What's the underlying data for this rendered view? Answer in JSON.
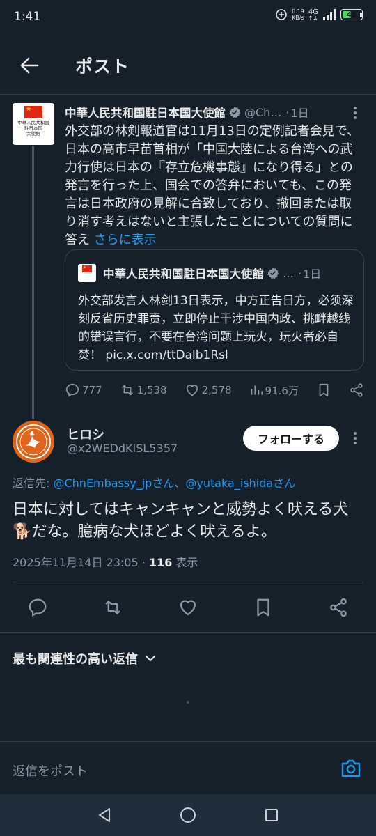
{
  "status_bar": {
    "time": "1:41",
    "speed_value": "0.19",
    "speed_unit": "KB/s",
    "network": "4G",
    "battery": "45",
    "battery_level": 0.45
  },
  "header": {
    "title": "ポスト",
    "back_icon": "arrow-left-icon"
  },
  "original_post": {
    "author_name": "中華人民共和国駐日本国大使館",
    "handle": "@Ch…",
    "separator": "·",
    "time": "1日",
    "avatar_text": "中華人民共和国駐日本国大使館",
    "text": "外交部の林剣報道官は11月13日の定例記者会見で、日本の高市早苗首相が「中国大陸による台湾への武力行使は日本の『存立危機事態』になり得る」との発言を行った上、国会での答弁においても、この発言は日本政府の見解に合致しており、撤回または取り消す考えはないと主張したことについての質問に答え",
    "show_more": "さらに表示",
    "quote": {
      "author_name": "中華人民共和国駐日本国大使館",
      "handle": "…",
      "separator": "·",
      "time": "1日",
      "text": "外交部发言人林剑13日表示，中方正告日方，必须深刻反省历史罪责，立即停止干涉中国内政、挑衅越线的错误言行，不要在台湾问题上玩火，玩火者必自焚！ pic.x.com/ttDalb1Rsl"
    },
    "actions": {
      "replies": "777",
      "reposts": "1,538",
      "likes": "2,578",
      "views": "91.6万"
    }
  },
  "reply": {
    "author_name": "ヒロシ",
    "handle": "@x2WEDdKISL5357",
    "follow_label": "フォローする",
    "reply_to_prefix": "返信先: ",
    "reply_to_user1": "@ChnEmbassy_jpさん",
    "reply_to_joiner": "、",
    "reply_to_user2": "@yutaka_ishidaさん",
    "text": "日本に対してはキャンキャンと威勢よく吠える犬🐕だな。臆病な犬ほどよく吠えるよ。",
    "date": "2025年11月14日 23:05 · ",
    "views_count": "116",
    "views_label": " 表示"
  },
  "replies_section": {
    "sort_label": "最も関連性の高い返信"
  },
  "compose": {
    "placeholder": "返信をポスト"
  },
  "colors": {
    "background": "#15202b",
    "accent": "#1d9bf0",
    "muted": "#8b98a5",
    "battery": "#4cd964"
  }
}
